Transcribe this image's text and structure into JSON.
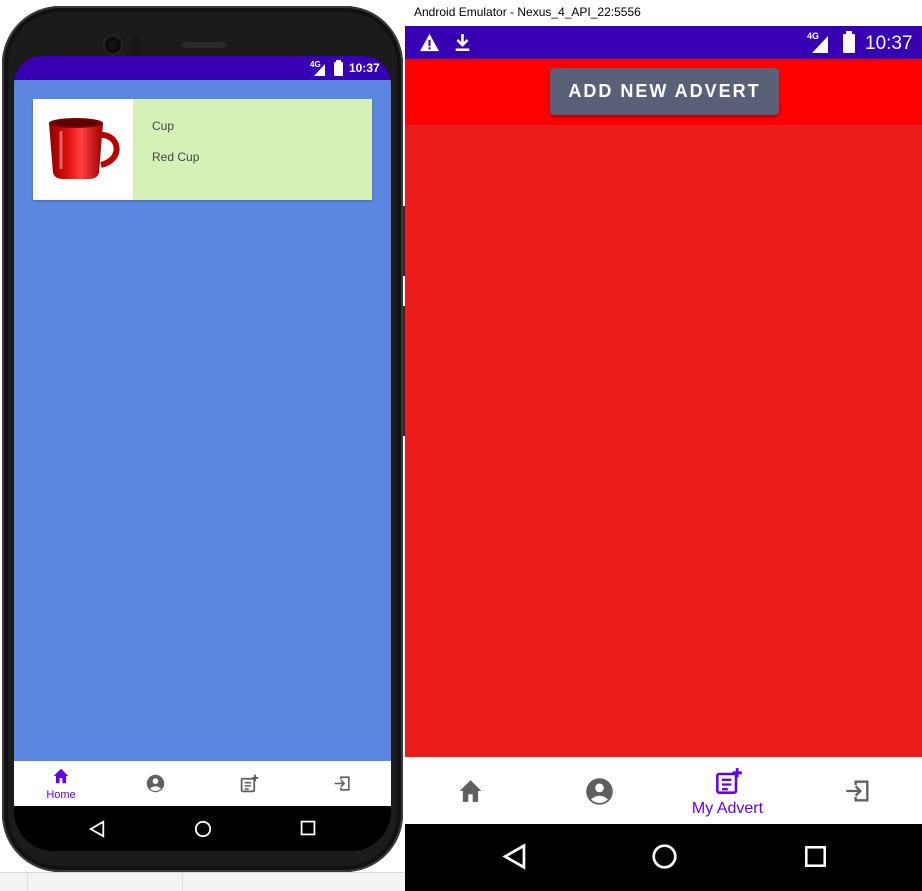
{
  "left_phone": {
    "status_bar": {
      "network": "4G",
      "time": "10:37"
    },
    "advert": {
      "title": "Cup",
      "description": "Red Cup",
      "image_icon": "red-mug"
    },
    "bottom_nav": {
      "items": [
        {
          "icon": "home-icon",
          "label": "Home",
          "active": true
        },
        {
          "icon": "account-icon",
          "label": "",
          "active": false
        },
        {
          "icon": "post-add-icon",
          "label": "",
          "active": false
        },
        {
          "icon": "logout-icon",
          "label": "",
          "active": false
        }
      ]
    },
    "system_nav": [
      "back-icon",
      "home-circle-icon",
      "recents-icon"
    ]
  },
  "emulator": {
    "window_title": "Android Emulator - Nexus_4_API_22:5556",
    "status_bar": {
      "network": "4G",
      "time": "10:37",
      "notification_icons": [
        "warning-icon",
        "download-icon"
      ]
    },
    "toolbar": {
      "add_button_label": "ADD NEW ADVERT"
    },
    "bottom_nav": {
      "items": [
        {
          "icon": "home-icon",
          "label": "",
          "active": false
        },
        {
          "icon": "account-icon",
          "label": "",
          "active": false
        },
        {
          "icon": "post-add-icon",
          "label": "My Advert",
          "active": true
        },
        {
          "icon": "logout-icon",
          "label": "",
          "active": false
        }
      ]
    },
    "system_nav": [
      "back-icon",
      "home-circle-icon",
      "recents-icon"
    ]
  },
  "colors": {
    "status_bar": "#3700b3",
    "primary": "#6200ee",
    "left_background": "#5b87e0",
    "card_info": "#d5f1b8",
    "toolbar_red": "#ff0000",
    "body_red": "#ed1c1c",
    "button": "#5a6078",
    "inactive_icon": "#5f5f5f"
  }
}
